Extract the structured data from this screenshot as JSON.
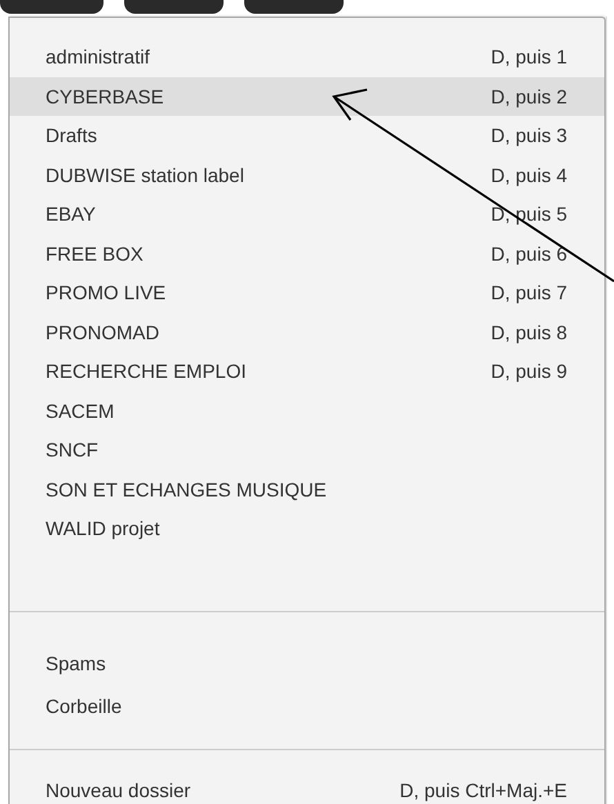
{
  "menu": {
    "sections": [
      {
        "items": [
          {
            "label": "administratif",
            "shortcut": "D, puis 1",
            "selected": false
          },
          {
            "label": "CYBERBASE",
            "shortcut": "D, puis 2",
            "selected": true
          },
          {
            "label": "Drafts",
            "shortcut": "D, puis 3",
            "selected": false
          },
          {
            "label": "DUBWISE station label",
            "shortcut": "D, puis 4",
            "selected": false
          },
          {
            "label": "EBAY",
            "shortcut": "D, puis 5",
            "selected": false
          },
          {
            "label": "FREE BOX",
            "shortcut": "D, puis 6",
            "selected": false
          },
          {
            "label": "PROMO LIVE",
            "shortcut": "D, puis 7",
            "selected": false
          },
          {
            "label": "PRONOMAD",
            "shortcut": "D, puis 8",
            "selected": false
          },
          {
            "label": "RECHERCHE EMPLOI",
            "shortcut": "D, puis 9",
            "selected": false
          },
          {
            "label": "SACEM",
            "selected": false
          },
          {
            "label": "SNCF",
            "selected": false
          },
          {
            "label": "SON ET ECHANGES MUSIQUE",
            "selected": false
          },
          {
            "label": "WALID projet",
            "selected": false
          }
        ]
      },
      {
        "items": [
          {
            "label": "Spams",
            "selected": false
          },
          {
            "label": "Corbeille",
            "selected": false
          }
        ]
      },
      {
        "items": [
          {
            "label": "Nouveau dossier",
            "shortcut": "D, puis Ctrl+Maj.+E",
            "selected": false
          }
        ]
      }
    ]
  }
}
